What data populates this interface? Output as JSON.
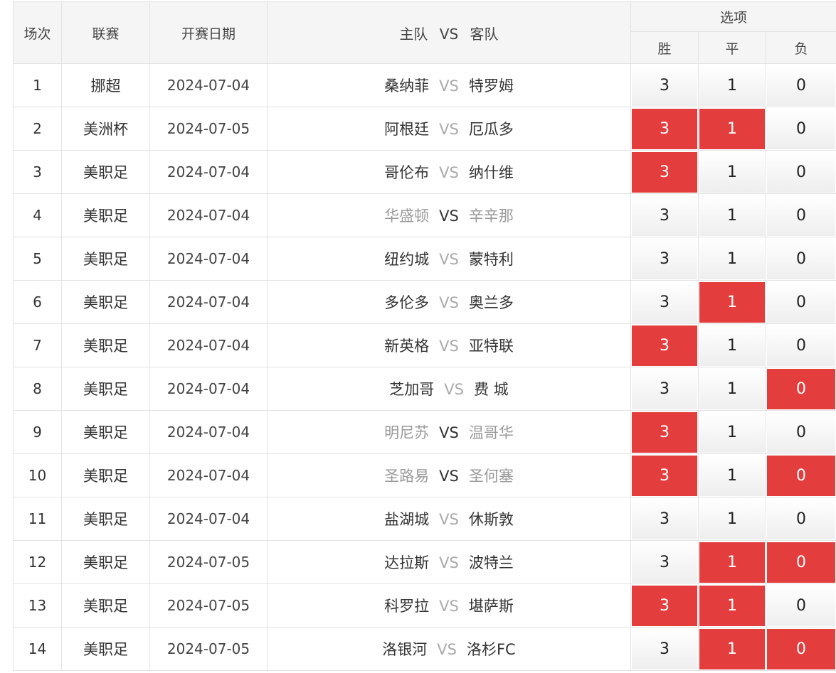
{
  "header": {
    "col_index": "场次",
    "col_league": "联赛",
    "col_date": "开赛日期",
    "col_match_home": "主队",
    "col_match_vs": "VS",
    "col_match_away": "客队",
    "col_options": "选项",
    "opt_win": "胜",
    "opt_draw": "平",
    "opt_lose": "负"
  },
  "rows": [
    {
      "idx": "1",
      "league": "挪超",
      "date": "2024-07-04",
      "home": "桑纳菲",
      "vs": "VS",
      "away": "特罗姆",
      "muted": false,
      "win": "3",
      "draw": "1",
      "lose": "0",
      "sel": {
        "win": false,
        "draw": false,
        "lose": false
      }
    },
    {
      "idx": "2",
      "league": "美洲杯",
      "date": "2024-07-05",
      "home": "阿根廷",
      "vs": "VS",
      "away": "厄瓜多",
      "muted": false,
      "win": "3",
      "draw": "1",
      "lose": "0",
      "sel": {
        "win": true,
        "draw": true,
        "lose": false
      }
    },
    {
      "idx": "3",
      "league": "美职足",
      "date": "2024-07-04",
      "home": "哥伦布",
      "vs": "VS",
      "away": "纳什维",
      "muted": false,
      "win": "3",
      "draw": "1",
      "lose": "0",
      "sel": {
        "win": true,
        "draw": false,
        "lose": false
      }
    },
    {
      "idx": "4",
      "league": "美职足",
      "date": "2024-07-04",
      "home": "华盛顿",
      "vs": "VS",
      "away": "辛辛那",
      "muted": true,
      "win": "3",
      "draw": "1",
      "lose": "0",
      "sel": {
        "win": false,
        "draw": false,
        "lose": false
      }
    },
    {
      "idx": "5",
      "league": "美职足",
      "date": "2024-07-04",
      "home": "纽约城",
      "vs": "VS",
      "away": "蒙特利",
      "muted": false,
      "win": "3",
      "draw": "1",
      "lose": "0",
      "sel": {
        "win": false,
        "draw": false,
        "lose": false
      }
    },
    {
      "idx": "6",
      "league": "美职足",
      "date": "2024-07-04",
      "home": "多伦多",
      "vs": "VS",
      "away": "奥兰多",
      "muted": false,
      "win": "3",
      "draw": "1",
      "lose": "0",
      "sel": {
        "win": false,
        "draw": true,
        "lose": false
      }
    },
    {
      "idx": "7",
      "league": "美职足",
      "date": "2024-07-04",
      "home": "新英格",
      "vs": "VS",
      "away": "亚特联",
      "muted": false,
      "win": "3",
      "draw": "1",
      "lose": "0",
      "sel": {
        "win": true,
        "draw": false,
        "lose": false
      }
    },
    {
      "idx": "8",
      "league": "美职足",
      "date": "2024-07-04",
      "home": "芝加哥",
      "vs": "VS",
      "away": "费 城",
      "muted": false,
      "win": "3",
      "draw": "1",
      "lose": "0",
      "sel": {
        "win": false,
        "draw": false,
        "lose": true
      }
    },
    {
      "idx": "9",
      "league": "美职足",
      "date": "2024-07-04",
      "home": "明尼苏",
      "vs": "VS",
      "away": "温哥华",
      "muted": true,
      "win": "3",
      "draw": "1",
      "lose": "0",
      "sel": {
        "win": true,
        "draw": false,
        "lose": false
      }
    },
    {
      "idx": "10",
      "league": "美职足",
      "date": "2024-07-04",
      "home": "圣路易",
      "vs": "VS",
      "away": "圣何塞",
      "muted": true,
      "win": "3",
      "draw": "1",
      "lose": "0",
      "sel": {
        "win": true,
        "draw": false,
        "lose": true
      }
    },
    {
      "idx": "11",
      "league": "美职足",
      "date": "2024-07-04",
      "home": "盐湖城",
      "vs": "VS",
      "away": "休斯敦",
      "muted": false,
      "win": "3",
      "draw": "1",
      "lose": "0",
      "sel": {
        "win": false,
        "draw": false,
        "lose": false
      }
    },
    {
      "idx": "12",
      "league": "美职足",
      "date": "2024-07-05",
      "home": "达拉斯",
      "vs": "VS",
      "away": "波特兰",
      "muted": false,
      "win": "3",
      "draw": "1",
      "lose": "0",
      "sel": {
        "win": false,
        "draw": true,
        "lose": true
      }
    },
    {
      "idx": "13",
      "league": "美职足",
      "date": "2024-07-05",
      "home": "科罗拉",
      "vs": "VS",
      "away": "堪萨斯",
      "muted": false,
      "win": "3",
      "draw": "1",
      "lose": "0",
      "sel": {
        "win": true,
        "draw": true,
        "lose": false
      }
    },
    {
      "idx": "14",
      "league": "美职足",
      "date": "2024-07-05",
      "home": "洛银河",
      "vs": "VS",
      "away": "洛杉FC",
      "muted": false,
      "win": "3",
      "draw": "1",
      "lose": "0",
      "sel": {
        "win": false,
        "draw": true,
        "lose": true
      }
    }
  ],
  "colors": {
    "selected": "#e33d3d",
    "header_bg": "#f5f5f5",
    "border": "#e2e2e2"
  }
}
